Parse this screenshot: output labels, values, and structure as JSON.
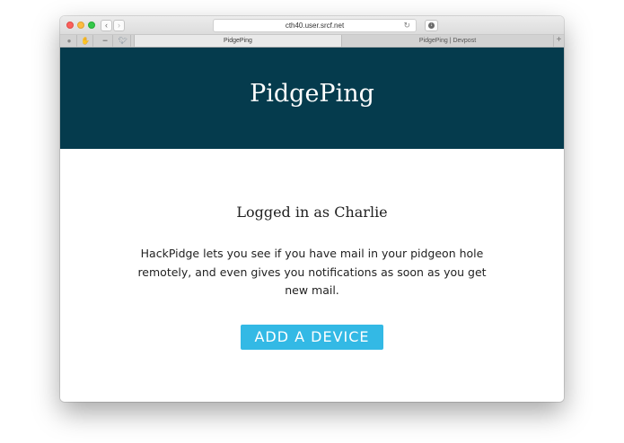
{
  "browser": {
    "url": "cth40.user.srcf.net",
    "tabs": [
      {
        "label": "PidgePing",
        "active": true
      },
      {
        "label": "PidgePing | Devpost",
        "active": false
      }
    ],
    "new_tab_label": "+",
    "icons": {
      "back": "chevron-left-icon",
      "forward": "chevron-right-icon",
      "reload": "reload-icon",
      "download": "download-icon"
    }
  },
  "page": {
    "site_title": "PidgePing",
    "logged_in_text": "Logged in as Charlie",
    "description": "HackPidge lets you see if you have mail in your pidgeon hole remotely, and even gives you notifications as soon as you get new mail.",
    "add_device_label": "ADD A DEVICE"
  },
  "colors": {
    "hero_bg": "#053b4d",
    "button_bg": "#33b9e5",
    "text": "#222222"
  }
}
